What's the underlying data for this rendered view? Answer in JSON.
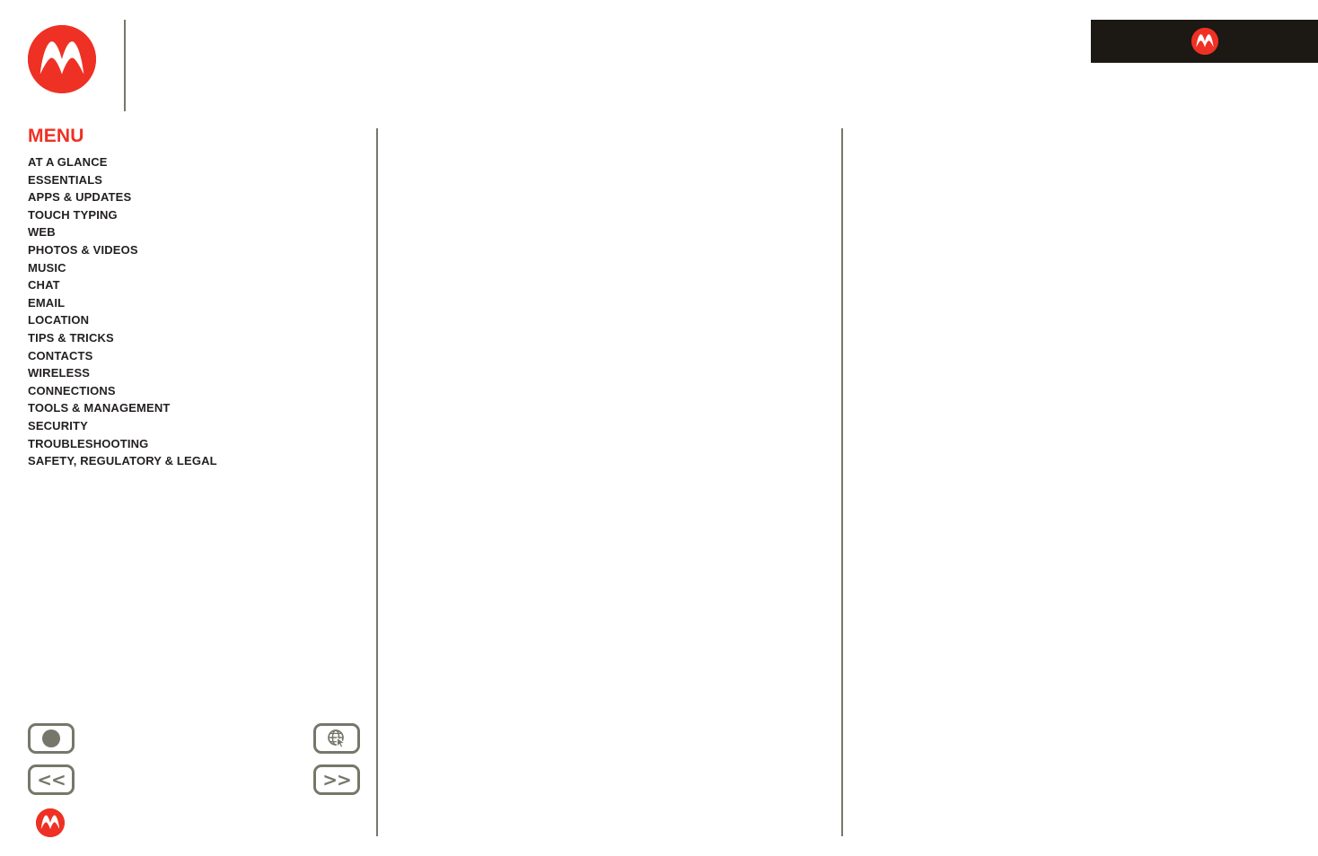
{
  "document": {
    "title": "Motorola User Guide",
    "brand_name": "Motorola"
  },
  "colors": {
    "brand_red": "#ee3124",
    "bar_black": "#1c1814",
    "rule_gray": "#76776a",
    "text_dark": "#231f20",
    "page_background": "#ffffff"
  },
  "brand_bar": {
    "logo_icon": "motorola-logo-icon"
  },
  "header": {
    "logo_icon": "motorola-logo-icon"
  },
  "sidebar": {
    "heading": "MENU",
    "items": [
      {
        "label": "AT A GLANCE"
      },
      {
        "label": "ESSENTIALS"
      },
      {
        "label": "APPS & UPDATES"
      },
      {
        "label": "TOUCH TYPING"
      },
      {
        "label": "WEB"
      },
      {
        "label": "PHOTOS & VIDEOS"
      },
      {
        "label": "MUSIC"
      },
      {
        "label": "CHAT"
      },
      {
        "label": "EMAIL"
      },
      {
        "label": "LOCATION"
      },
      {
        "label": "TIPS & TRICKS"
      },
      {
        "label": "CONTACTS"
      },
      {
        "label": "WIRELESS"
      },
      {
        "label": "CONNECTIONS"
      },
      {
        "label": "TOOLS & MANAGEMENT"
      },
      {
        "label": "SECURITY"
      },
      {
        "label": "TROUBLESHOOTING"
      },
      {
        "label": "SAFETY, REGULATORY & LEGAL"
      }
    ]
  },
  "navigation": {
    "home": {
      "icon": "filled-circle-icon",
      "label": ""
    },
    "back": {
      "icon": "previous-page-icon",
      "label": "<<"
    },
    "web": {
      "icon": "globe-cursor-icon",
      "label": ""
    },
    "forward": {
      "icon": "next-page-icon",
      "label": ">>"
    },
    "footer_logo_icon": "motorola-logo-icon"
  },
  "content": {
    "column_one_text": "",
    "column_two_text": ""
  }
}
